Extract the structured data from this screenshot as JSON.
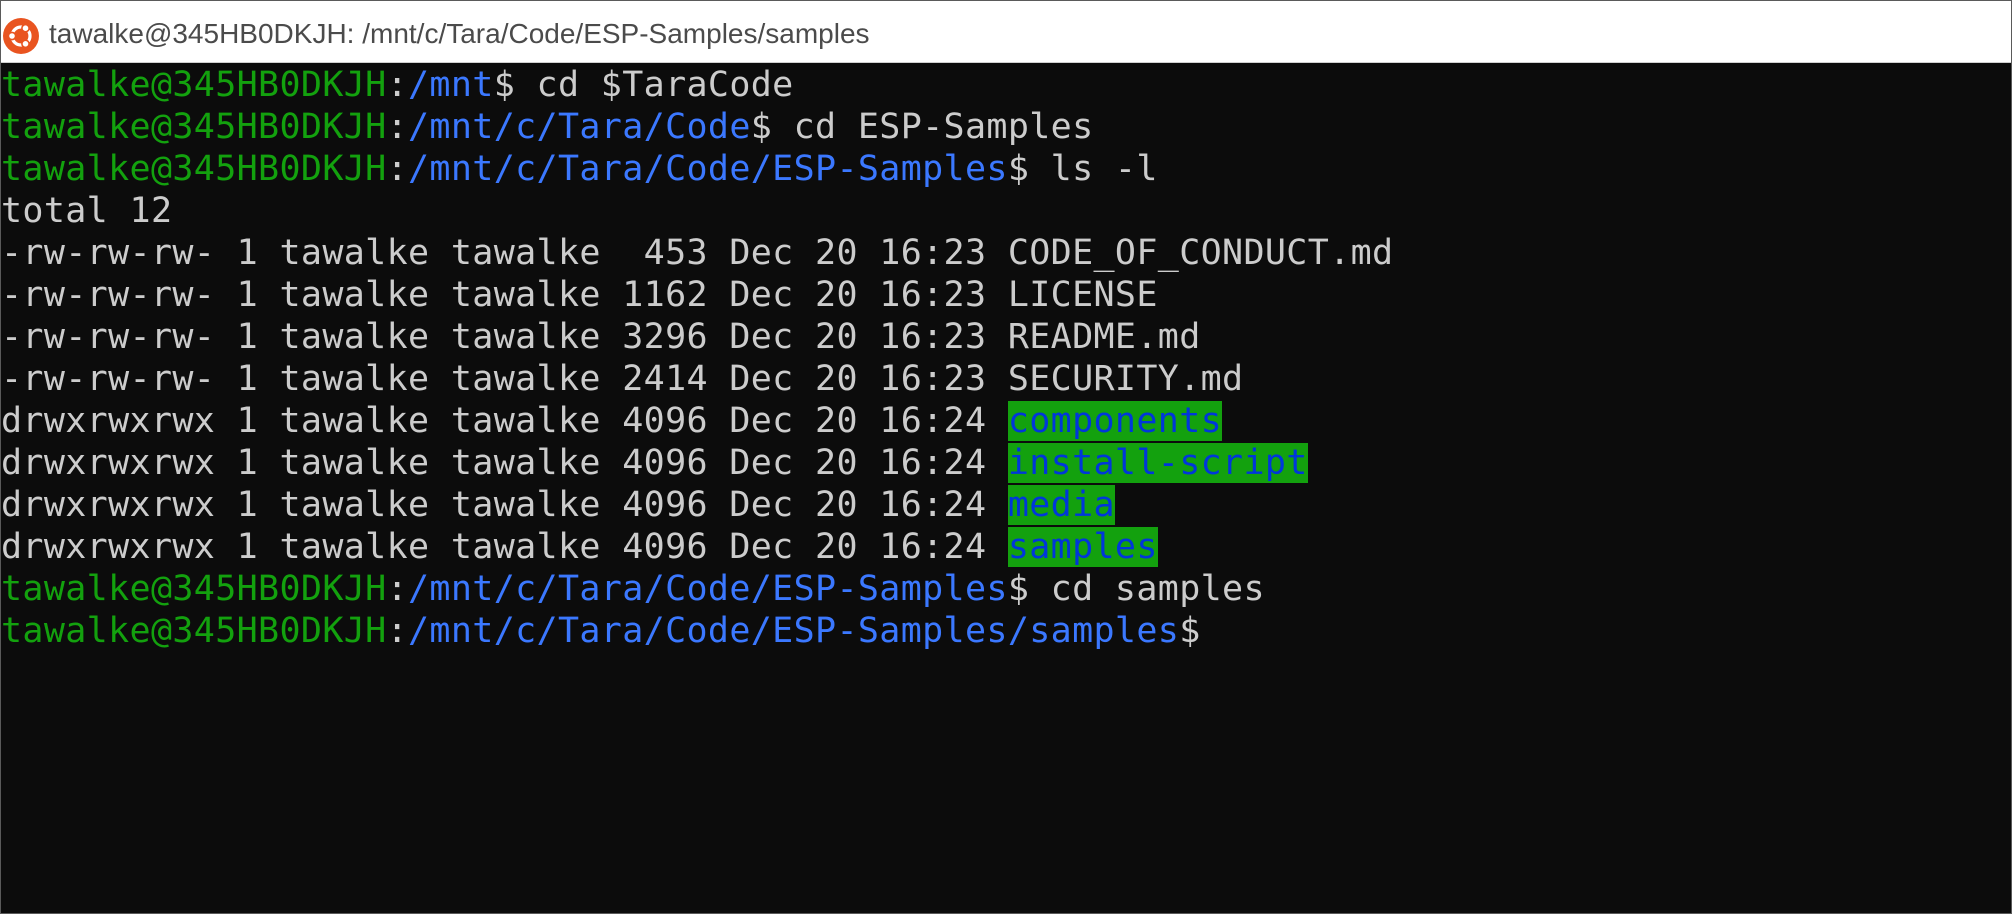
{
  "window": {
    "title": "tawalke@345HB0DKJH: /mnt/c/Tara/Code/ESP-Samples/samples",
    "icon": "ubuntu-icon"
  },
  "colors": {
    "background": "#0c0c0c",
    "user_green": "#13a10e",
    "path_blue": "#3b78ff",
    "text": "#cccccc",
    "dir_bg": "#13a10e",
    "dir_fg": "#0037da"
  },
  "terminal": {
    "prompts": [
      {
        "user": "tawalke@345HB0DKJH",
        "sep": ":",
        "path": "/mnt",
        "dollar": "$",
        "cmd": " cd $TaraCode"
      },
      {
        "user": "tawalke@345HB0DKJH",
        "sep": ":",
        "path": "/mnt/c/Tara/Code",
        "dollar": "$",
        "cmd": " cd ESP-Samples"
      },
      {
        "user": "tawalke@345HB0DKJH",
        "sep": ":",
        "path": "/mnt/c/Tara/Code/ESP-Samples",
        "dollar": "$",
        "cmd": " ls -l"
      }
    ],
    "total": "total 12",
    "files": [
      {
        "meta": "-rw-rw-rw- 1 tawalke tawalke  453 Dec 20 16:23 ",
        "name": "CODE_OF_CONDUCT.md"
      },
      {
        "meta": "-rw-rw-rw- 1 tawalke tawalke 1162 Dec 20 16:23 ",
        "name": "LICENSE"
      },
      {
        "meta": "-rw-rw-rw- 1 tawalke tawalke 3296 Dec 20 16:23 ",
        "name": "README.md"
      },
      {
        "meta": "-rw-rw-rw- 1 tawalke tawalke 2414 Dec 20 16:23 ",
        "name": "SECURITY.md"
      }
    ],
    "dirs": [
      {
        "meta": "drwxrwxrwx 1 tawalke tawalke 4096 Dec 20 16:24 ",
        "name": "components"
      },
      {
        "meta": "drwxrwxrwx 1 tawalke tawalke 4096 Dec 20 16:24 ",
        "name": "install-script"
      },
      {
        "meta": "drwxrwxrwx 1 tawalke tawalke 4096 Dec 20 16:24 ",
        "name": "media"
      },
      {
        "meta": "drwxrwxrwx 1 tawalke tawalke 4096 Dec 20 16:24 ",
        "name": "samples"
      }
    ],
    "after": [
      {
        "user": "tawalke@345HB0DKJH",
        "sep": ":",
        "path": "/mnt/c/Tara/Code/ESP-Samples",
        "dollar": "$",
        "cmd": " cd samples"
      },
      {
        "user": "tawalke@345HB0DKJH",
        "sep": ":",
        "path": "/mnt/c/Tara/Code/ESP-Samples/samples",
        "dollar": "$",
        "cmd": ""
      }
    ]
  }
}
